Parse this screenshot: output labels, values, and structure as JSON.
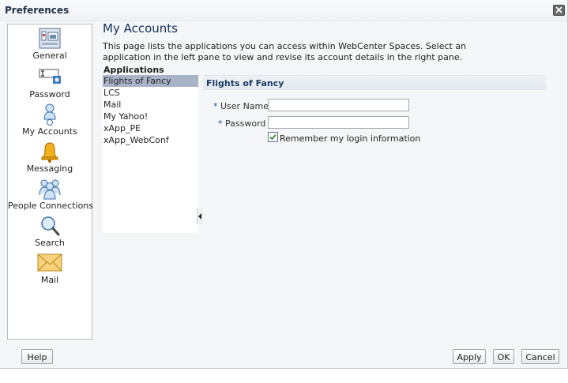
{
  "dialog": {
    "title": "Preferences"
  },
  "nav": {
    "items": [
      {
        "label": "General",
        "icon": "general-icon"
      },
      {
        "label": "Password",
        "icon": "password-icon"
      },
      {
        "label": "My Accounts",
        "icon": "my-accounts-icon"
      },
      {
        "label": "Messaging",
        "icon": "bell-icon"
      },
      {
        "label": "People Connections",
        "icon": "people-icon"
      },
      {
        "label": "Search",
        "icon": "magnifier-icon"
      },
      {
        "label": "Mail",
        "icon": "envelope-icon"
      }
    ]
  },
  "main": {
    "title": "My Accounts",
    "description": "This page lists the applications you can access within WebCenter Spaces. Select an application in the left pane to view and revise its account details in the right pane.",
    "apps_header": "Applications",
    "apps": [
      "Flights of Fancy",
      "LCS",
      "Mail",
      "My Yahoo!",
      "xApp_PE",
      "xApp_WebConf"
    ],
    "selected_app": "Flights of Fancy"
  },
  "detail": {
    "title": "Flights of Fancy",
    "required_marker": "*",
    "username_label": "User Name",
    "username_value": "",
    "password_label": "Password",
    "password_value": "",
    "remember_label": "Remember my login information",
    "remember_checked": true
  },
  "buttons": {
    "help": "Help",
    "apply": "Apply",
    "ok": "OK",
    "cancel": "Cancel"
  },
  "colors": {
    "selected_row": "#a8b3c7",
    "title_text": "#12315a",
    "required": "#1c4f9c"
  }
}
